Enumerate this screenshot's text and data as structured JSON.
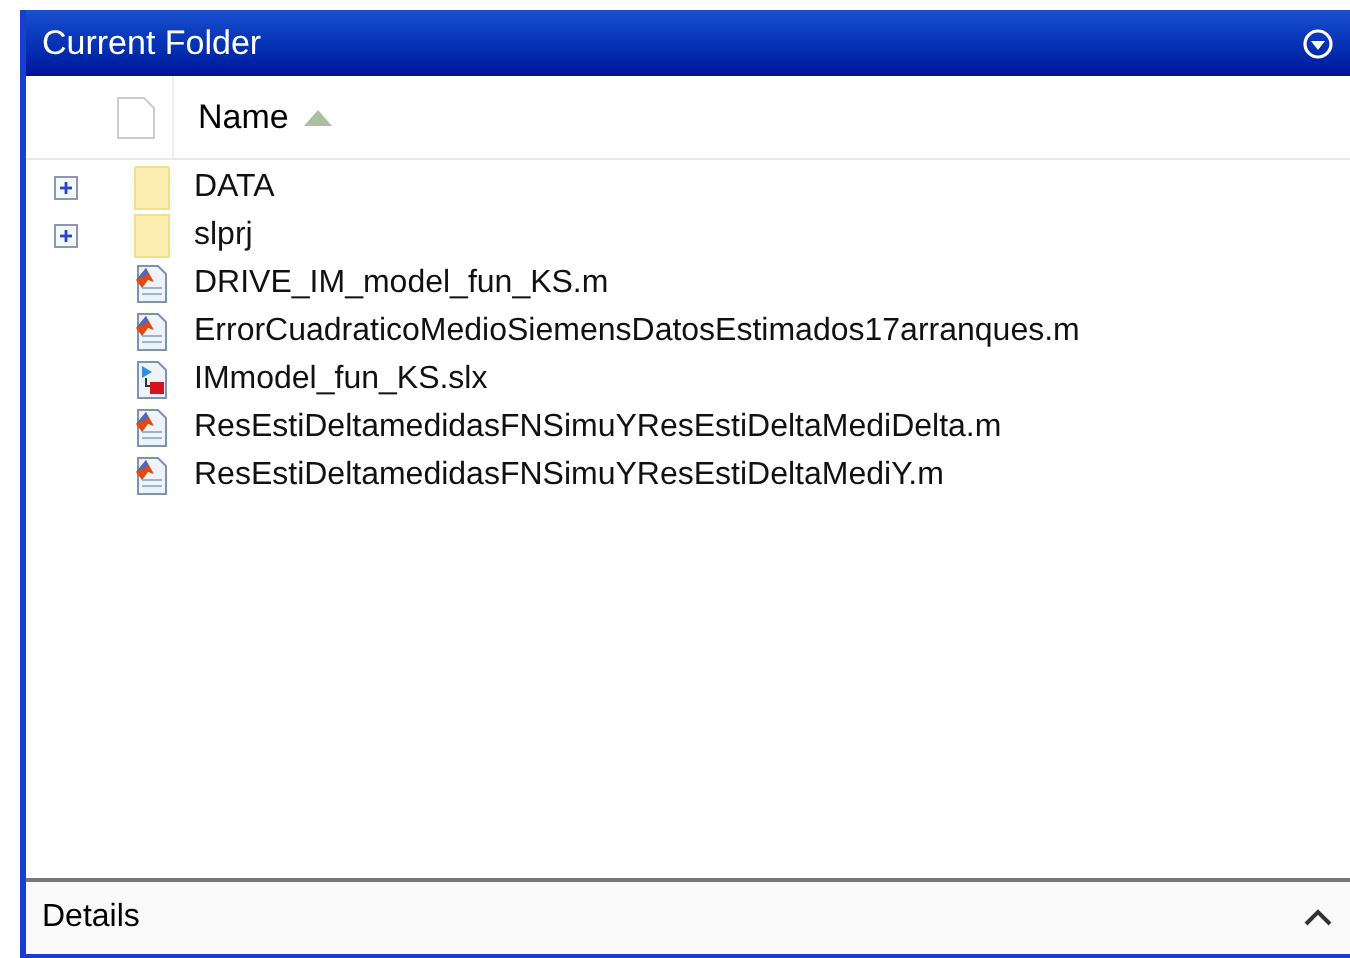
{
  "panel": {
    "title": "Current Folder"
  },
  "columns": [
    {
      "label": "Name",
      "sorted_ascending": true
    }
  ],
  "files": [
    {
      "name": "DATA",
      "kind": "folder",
      "expanded": false
    },
    {
      "name": "slprj",
      "kind": "folder",
      "expanded": false
    },
    {
      "name": "DRIVE_IM_model_fun_KS.m",
      "kind": "script"
    },
    {
      "name": "ErrorCuadraticoMedioSiemensDatosEstimados17arranques.m",
      "kind": "script"
    },
    {
      "name": "IMmodel_fun_KS.slx",
      "kind": "model"
    },
    {
      "name": "ResEstiDeltamedidasFNSimuYResEstiDeltaMediDelta.m",
      "kind": "script"
    },
    {
      "name": "ResEstiDeltamedidasFNSimuYResEstiDeltaMediY.m",
      "kind": "script"
    }
  ],
  "details": {
    "label": "Details",
    "expanded": false
  }
}
